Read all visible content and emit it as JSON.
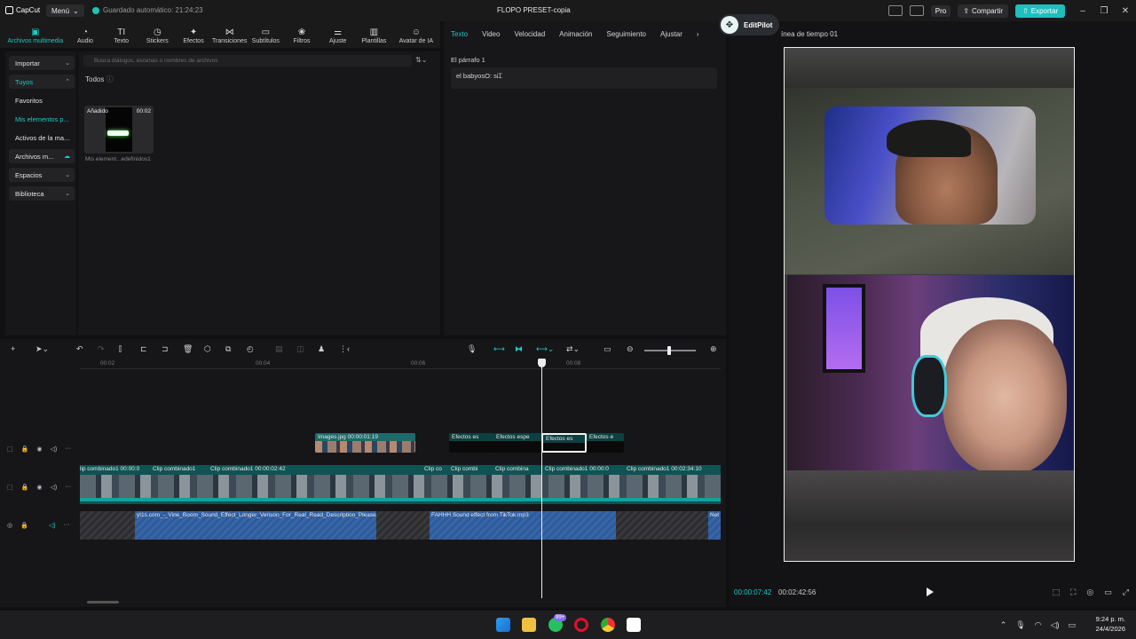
{
  "titlebar": {
    "logo_text": "CapCut",
    "menu_label": "Menú",
    "autosave_text": "Guardado automático: 21:24:23",
    "doc_title": "FLOPO PRESET-copia",
    "pro_label": "Pro",
    "share_label": "Compartir",
    "export_label": "Exportar"
  },
  "tools": [
    {
      "label": "Archivos multimedia",
      "icon": "media-icon"
    },
    {
      "label": "Audio",
      "icon": "audio-icon"
    },
    {
      "label": "Texto",
      "icon": "text-icon"
    },
    {
      "label": "Stickers",
      "icon": "sticker-icon"
    },
    {
      "label": "Efectos",
      "icon": "effects-icon"
    },
    {
      "label": "Transiciones",
      "icon": "transition-icon"
    },
    {
      "label": "Subtítulos",
      "icon": "subtitles-icon"
    },
    {
      "label": "Filtros",
      "icon": "filter-icon"
    },
    {
      "label": "Ajuste",
      "icon": "adjust-icon"
    },
    {
      "label": "Plantillas",
      "icon": "template-icon"
    },
    {
      "label": "Avatar de IA",
      "icon": "avatar-icon"
    }
  ],
  "sidebar": {
    "items": [
      {
        "label": "Importar"
      },
      {
        "label": "Tuyos"
      },
      {
        "label": "Favoritos"
      },
      {
        "label": "Mis elementos p..."
      },
      {
        "label": "Activos de la ma..."
      },
      {
        "label": "Archivos m..."
      },
      {
        "label": "Espacios"
      },
      {
        "label": "Biblioteca"
      }
    ]
  },
  "media": {
    "search_placeholder": "Busca diálogos, escenas o nombres de archivos",
    "todos_label": "Todos",
    "thumb": {
      "added": "Añadido",
      "duration": "00:02",
      "caption": "Mis element...edefinidos1"
    }
  },
  "props": {
    "tabs": [
      "Texto",
      "Video",
      "Velocidad",
      "Animación",
      "Seguimiento",
      "Ajustar"
    ],
    "paragraph_label": "El párrafo 1",
    "paragraph_text": "el babyosO: si"
  },
  "player": {
    "editpilot_label": "EditPilot",
    "title": "ínea de tiempo 01",
    "current_time": "00:00:07:42",
    "total_time": "00:02:42:56"
  },
  "timeline": {
    "ruler": [
      "00:02",
      "00:04",
      "00:06",
      "00:08"
    ],
    "overlay_clips": [
      {
        "label": "Images.jpg   00:00:01:19"
      },
      {
        "label": "Efectos es"
      },
      {
        "label": "Efectos espe"
      },
      {
        "label": "Efectos es"
      },
      {
        "label": "Efectos e"
      }
    ],
    "main_clips": [
      {
        "label": "lip combinado1   00:00:0"
      },
      {
        "label": "Clip combinado1"
      },
      {
        "label": "Clip combinado1   00:00:02:42"
      },
      {
        "label": "Clip co"
      },
      {
        "label": "Clip combi"
      },
      {
        "label": "Clip combina"
      },
      {
        "label": "Clip combinado1   00:00:0"
      },
      {
        "label": "Clip combinado1   00:02:34:10"
      }
    ],
    "audio_clips": [
      {
        "label": "yt1s.com_-_Vine_Boom_Sound_Effect_Longer_Verison_For_Real_Read_Description_Please.e"
      },
      {
        "label": "FAHHH Sound effect from TikTok.mp3"
      },
      {
        "label": "Net"
      }
    ]
  },
  "taskbar": {
    "badge": "99+",
    "time": "9:24 p. m.",
    "date": "24/4/2026"
  }
}
